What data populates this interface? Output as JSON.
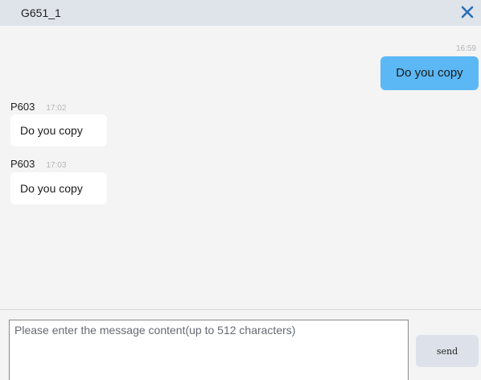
{
  "window": {
    "title": "G651_1",
    "close_icon": "close-icon"
  },
  "messages": [
    {
      "direction": "outgoing",
      "time": "16:59",
      "text": "Do you copy"
    },
    {
      "direction": "incoming",
      "sender": "P603",
      "time": "17:02",
      "text": "Do you copy"
    },
    {
      "direction": "incoming",
      "sender": "P603",
      "time": "17:03",
      "text": "Do you copy"
    }
  ],
  "composer": {
    "placeholder": "Please enter the message content(up to 512 characters)",
    "value": "",
    "send_label": "send"
  },
  "colors": {
    "titlebar": "#dfe3ea",
    "chat_background": "#f4f4f4",
    "outgoing_bubble": "#5bb8f4",
    "incoming_bubble": "#ffffff",
    "close_icon": "#2a6fb5",
    "send_button": "#dde2ea"
  }
}
